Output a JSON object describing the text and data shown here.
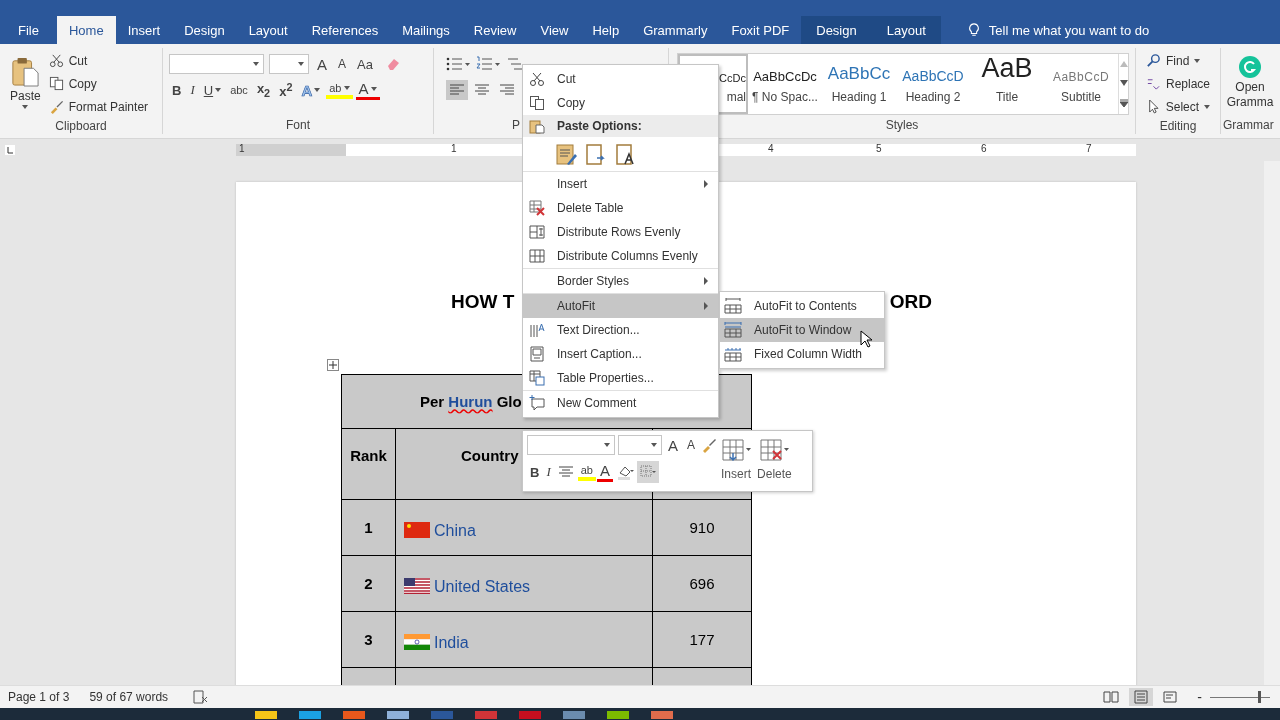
{
  "tabs": [
    {
      "label": "File",
      "selected": false,
      "kind": "file"
    },
    {
      "label": "Home",
      "selected": true,
      "kind": "main"
    },
    {
      "label": "Insert",
      "selected": false,
      "kind": "main"
    },
    {
      "label": "Design",
      "selected": false,
      "kind": "main"
    },
    {
      "label": "Layout",
      "selected": false,
      "kind": "main"
    },
    {
      "label": "References",
      "selected": false,
      "kind": "main"
    },
    {
      "label": "Mailings",
      "selected": false,
      "kind": "main"
    },
    {
      "label": "Review",
      "selected": false,
      "kind": "main"
    },
    {
      "label": "View",
      "selected": false,
      "kind": "main"
    },
    {
      "label": "Help",
      "selected": false,
      "kind": "main"
    },
    {
      "label": "Grammarly",
      "selected": false,
      "kind": "main"
    },
    {
      "label": "Foxit PDF",
      "selected": false,
      "kind": "main"
    },
    {
      "label": "Design",
      "selected": false,
      "kind": "contextual"
    },
    {
      "label": "Layout",
      "selected": false,
      "kind": "contextual"
    }
  ],
  "tell_me": "Tell me what you want to do",
  "clipboard": {
    "paste": "Paste",
    "items": [
      "Cut",
      "Copy",
      "Format Painter"
    ],
    "label": "Clipboard"
  },
  "font": {
    "label": "Font",
    "row1": [
      {
        "kind": "grow",
        "text": "A"
      },
      {
        "kind": "shrink",
        "text": "A"
      },
      {
        "kind": "case",
        "text": "Aa"
      }
    ],
    "row2": [
      {
        "kind": "bold",
        "text": "B",
        "dropdown": false
      },
      {
        "kind": "italic",
        "text": "I",
        "dropdown": false
      },
      {
        "kind": "underline",
        "text": "U",
        "dropdown": true
      },
      {
        "kind": "strike",
        "text": "abc",
        "dropdown": false
      },
      {
        "kind": "script",
        "text": "x$_{2}$",
        "dropdown": false
      },
      {
        "kind": "script",
        "text": "x$^{2}$",
        "dropdown": false
      },
      {
        "kind": "effect",
        "text": "A",
        "dropdown": true
      },
      {
        "kind": "highlight",
        "text": "ab",
        "dropdown": true
      },
      {
        "kind": "color",
        "text": "A",
        "dropdown": true
      }
    ]
  },
  "paragraph": {
    "label": "P",
    "align": [
      {
        "selected": true
      },
      {
        "selected": false
      },
      {
        "selected": false
      }
    ]
  },
  "styles": {
    "label": "Styles",
    "items": [
      {
        "kind": "normal",
        "preview": "CcDc",
        "name": "mal",
        "selected": true
      },
      {
        "kind": "plain",
        "preview": "AaBbCcDc",
        "name": "¶ No Spac...",
        "selected": false
      },
      {
        "kind": "heading1",
        "preview": "AaBbCc",
        "name": "Heading 1",
        "selected": false
      },
      {
        "kind": "heading2",
        "preview": "AaBbCcD",
        "name": "Heading 2",
        "selected": false
      },
      {
        "kind": "title",
        "preview": "AaB",
        "name": "Title",
        "selected": false
      },
      {
        "kind": "subtitle",
        "preview": "AaBbCcD",
        "name": "Subtitle",
        "selected": false
      }
    ]
  },
  "editing": {
    "label": "Editing",
    "items": [
      {
        "kind": "find",
        "text": "Find",
        "dropdown": true
      },
      {
        "kind": "replace",
        "text": "Replace",
        "dropdown": false
      },
      {
        "kind": "select",
        "text": "Select",
        "dropdown": true
      }
    ]
  },
  "grammarly": {
    "button": [
      "Open",
      "Gramma"
    ],
    "label": "Grammar"
  },
  "ruler": {
    "numbers": [
      "1",
      "1",
      "4",
      "5",
      "6",
      "7"
    ]
  },
  "document": {
    "heading_left": "HOW T",
    "heading_right": "ORD",
    "table": {
      "title": {
        "before": "Per ",
        "marked": "Hurun",
        "after": " Glo"
      },
      "headers": [
        "Rank",
        "Country"
      ],
      "rows": [
        {
          "rank": "1",
          "country": "China",
          "count": "910"
        },
        {
          "rank": "2",
          "country": "United States",
          "count": "696"
        },
        {
          "rank": "3",
          "country": "India",
          "count": "177"
        }
      ]
    }
  },
  "context_menu": {
    "items": [
      {
        "kind": "item",
        "label": "Cut",
        "submenu": false,
        "selected": false,
        "separator": false
      },
      {
        "kind": "item",
        "label": "Copy",
        "submenu": false,
        "selected": false,
        "separator": false
      },
      {
        "kind": "header",
        "label": "Paste Options:"
      },
      {
        "kind": "paste_row"
      },
      {
        "kind": "item",
        "label": "Insert",
        "submenu": true,
        "selected": false,
        "separator": true
      },
      {
        "kind": "item",
        "label": "Delete Table",
        "submenu": false,
        "selected": false,
        "separator": false
      },
      {
        "kind": "item",
        "label": "Distribute Rows Evenly",
        "submenu": false,
        "selected": false,
        "separator": false
      },
      {
        "kind": "item",
        "label": "Distribute Columns Evenly",
        "submenu": false,
        "selected": false,
        "separator": false
      },
      {
        "kind": "item",
        "label": "Border Styles",
        "submenu": true,
        "selected": false,
        "separator": true
      },
      {
        "kind": "item",
        "label": "AutoFit",
        "submenu": true,
        "selected": true,
        "separator": true
      },
      {
        "kind": "item",
        "label": "Text Direction...",
        "submenu": false,
        "selected": false,
        "separator": false
      },
      {
        "kind": "item",
        "label": "Insert Caption...",
        "submenu": false,
        "selected": false,
        "separator": false
      },
      {
        "kind": "item",
        "label": "Table Properties...",
        "submenu": false,
        "selected": false,
        "separator": false
      },
      {
        "kind": "item",
        "label": "New Comment",
        "submenu": false,
        "selected": false,
        "separator": true
      }
    ]
  },
  "submenu": {
    "items": [
      {
        "label": "AutoFit to Contents",
        "selected": false
      },
      {
        "label": "AutoFit to Window",
        "selected": true
      },
      {
        "label": "Fixed Column Width",
        "selected": false
      }
    ]
  },
  "mini_toolbar": {
    "row1": [
      {
        "kind": "grow",
        "text": "A"
      },
      {
        "kind": "shrink",
        "text": "A"
      }
    ],
    "row2": [
      {
        "kind": "bold",
        "text": "B",
        "selected": false
      },
      {
        "kind": "italic",
        "text": "I",
        "selected": false
      },
      {
        "kind": "center",
        "selected": false
      },
      {
        "kind": "highlight",
        "text": "ab",
        "selected": false
      },
      {
        "kind": "color",
        "text": "A",
        "selected": false
      },
      {
        "kind": "shading",
        "selected": false
      },
      {
        "kind": "borders",
        "selected": true
      }
    ],
    "buttons": [
      {
        "kind": "insert",
        "label": "Insert"
      },
      {
        "kind": "delete",
        "label": "Delete"
      }
    ]
  },
  "status_bar": {
    "page": "Page 1 of 3",
    "words": "59 of 67 words",
    "views": [
      {
        "kind": "read",
        "selected": false
      },
      {
        "kind": "print",
        "selected": true
      },
      {
        "kind": "web",
        "selected": false
      }
    ],
    "zoom_minus": "-",
    "zoom": {
      "level": 0.85
    }
  }
}
